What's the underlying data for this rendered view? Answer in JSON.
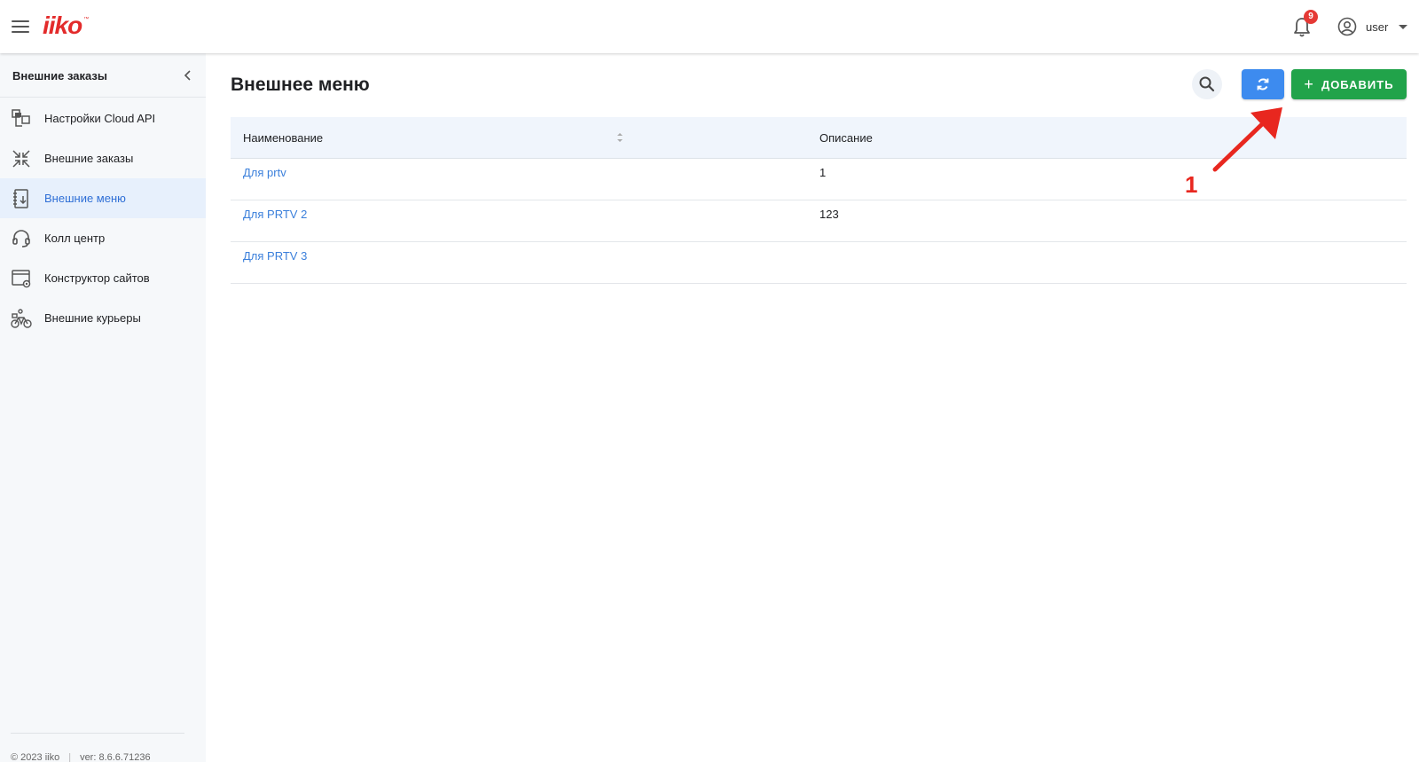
{
  "app": {
    "logo": "iiko",
    "logo_tm": "™"
  },
  "header": {
    "notifications_count": "9",
    "user_name": "user"
  },
  "sidebar": {
    "title": "Внешние заказы",
    "items": [
      {
        "label": "Настройки Cloud API",
        "icon": "cloud-api-settings-icon",
        "active": false
      },
      {
        "label": "Внешние заказы",
        "icon": "external-orders-icon",
        "active": false
      },
      {
        "label": "Внешние меню",
        "icon": "external-menu-icon",
        "active": true
      },
      {
        "label": "Колл центр",
        "icon": "headset-icon",
        "active": false
      },
      {
        "label": "Конструктор сайтов",
        "icon": "site-builder-icon",
        "active": false
      },
      {
        "label": "Внешние курьеры",
        "icon": "courier-bike-icon",
        "active": false
      }
    ],
    "footer": {
      "copyright": "© 2023 iiko",
      "version": "ver: 8.6.6.71236"
    }
  },
  "main": {
    "title": "Внешнее меню",
    "add_label": "ДОБАВИТЬ",
    "table": {
      "columns": [
        "Наименование",
        "Описание"
      ],
      "rows": [
        {
          "name": "Для prtv",
          "description": "1"
        },
        {
          "name": "Для PRTV 2",
          "description": "123"
        },
        {
          "name": "Для PRTV 3",
          "description": ""
        }
      ]
    }
  },
  "annotation": {
    "number": "1",
    "color": "#e8271f"
  },
  "colors": {
    "accent_blue": "#3d8bef",
    "add_green": "#21a34a",
    "link_blue": "#3a7fdb",
    "active_bg": "#e7f0fc"
  }
}
